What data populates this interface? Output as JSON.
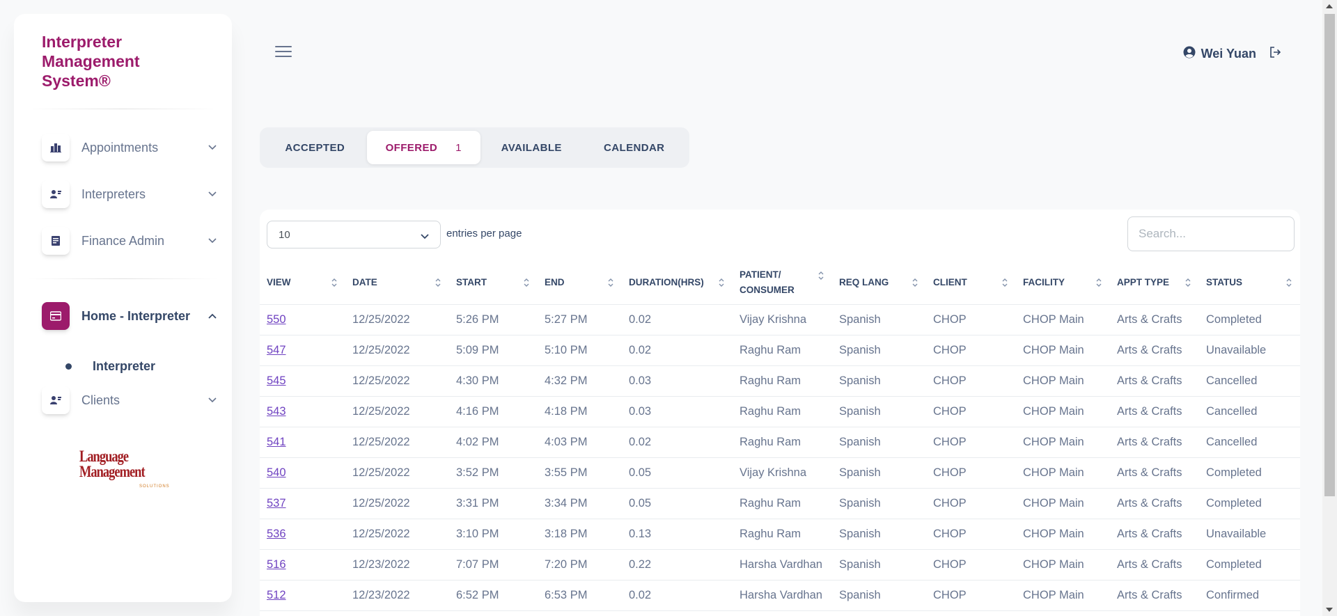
{
  "brand": {
    "title": "Interpreter Management System®"
  },
  "sidebar": {
    "items": [
      {
        "label": "Appointments",
        "icon": "building-icon"
      },
      {
        "label": "Interpreters",
        "icon": "user-card-icon"
      },
      {
        "label": "Finance Admin",
        "icon": "document-icon"
      },
      {
        "label": "Home - Interpreter",
        "icon": "card-icon",
        "active": true
      },
      {
        "label": "Clients",
        "icon": "user-card-icon"
      }
    ],
    "sub_item": "Interpreter",
    "logo": {
      "line1": "Language",
      "line2": "Management",
      "line3": "SOLUTIONS"
    }
  },
  "header": {
    "user_name": "Wei Yuan"
  },
  "tabs": [
    {
      "label": "ACCEPTED"
    },
    {
      "label": "OFFERED",
      "badge": "1",
      "active": true
    },
    {
      "label": "AVAILABLE"
    },
    {
      "label": "CALENDAR"
    }
  ],
  "table_controls": {
    "page_size": "10",
    "entries_label": "entries per page",
    "search_placeholder": "Search..."
  },
  "table": {
    "columns": [
      "VIEW",
      "DATE",
      "START",
      "END",
      "DURATION(HRS)",
      "PATIENT/ CONSUMER",
      "REQ LANG",
      "CLIENT",
      "FACILITY",
      "APPT TYPE",
      "STATUS"
    ],
    "rows": [
      [
        "550",
        "12/25/2022",
        "5:26 PM",
        "5:27 PM",
        "0.02",
        "Vijay Krishna",
        "Spanish",
        "CHOP",
        "CHOP Main",
        "Arts & Crafts",
        "Completed"
      ],
      [
        "547",
        "12/25/2022",
        "5:09 PM",
        "5:10 PM",
        "0.02",
        "Raghu Ram",
        "Spanish",
        "CHOP",
        "CHOP Main",
        "Arts & Crafts",
        "Unavailable"
      ],
      [
        "545",
        "12/25/2022",
        "4:30 PM",
        "4:32 PM",
        "0.03",
        "Raghu Ram",
        "Spanish",
        "CHOP",
        "CHOP Main",
        "Arts & Crafts",
        "Cancelled"
      ],
      [
        "543",
        "12/25/2022",
        "4:16 PM",
        "4:18 PM",
        "0.03",
        "Raghu Ram",
        "Spanish",
        "CHOP",
        "CHOP Main",
        "Arts & Crafts",
        "Cancelled"
      ],
      [
        "541",
        "12/25/2022",
        "4:02 PM",
        "4:03 PM",
        "0.02",
        "Raghu Ram",
        "Spanish",
        "CHOP",
        "CHOP Main",
        "Arts & Crafts",
        "Cancelled"
      ],
      [
        "540",
        "12/25/2022",
        "3:52 PM",
        "3:55 PM",
        "0.05",
        "Vijay Krishna",
        "Spanish",
        "CHOP",
        "CHOP Main",
        "Arts & Crafts",
        "Completed"
      ],
      [
        "537",
        "12/25/2022",
        "3:31 PM",
        "3:34 PM",
        "0.05",
        "Raghu Ram",
        "Spanish",
        "CHOP",
        "CHOP Main",
        "Arts & Crafts",
        "Completed"
      ],
      [
        "536",
        "12/25/2022",
        "3:10 PM",
        "3:18 PM",
        "0.13",
        "Raghu Ram",
        "Spanish",
        "CHOP",
        "CHOP Main",
        "Arts & Crafts",
        "Unavailable"
      ],
      [
        "516",
        "12/23/2022",
        "7:07 PM",
        "7:20 PM",
        "0.22",
        "Harsha Vardhan",
        "Spanish",
        "CHOP",
        "CHOP Main",
        "Arts & Crafts",
        "Completed"
      ],
      [
        "512",
        "12/23/2022",
        "6:52 PM",
        "6:53 PM",
        "0.02",
        "Harsha Vardhan",
        "Spanish",
        "CHOP",
        "CHOP Main",
        "Arts & Crafts",
        "Confirmed"
      ]
    ]
  },
  "colors": {
    "brand": "#9c1b6b",
    "text": "#344767",
    "muted": "#67748e",
    "link": "#6f42c1"
  }
}
